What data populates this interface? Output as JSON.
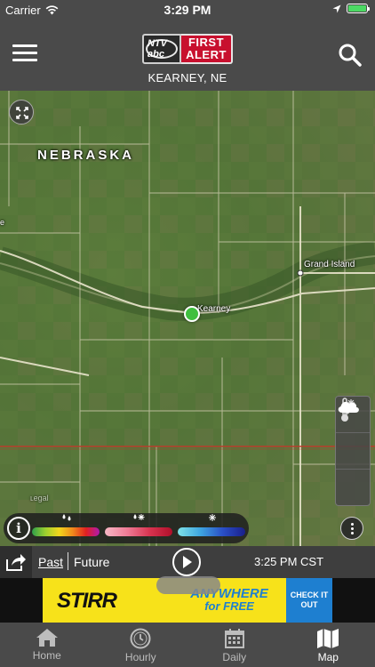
{
  "status_bar": {
    "carrier": "Carrier",
    "time": "3:29 PM"
  },
  "header": {
    "logo": {
      "station": "NTV abc",
      "brand_line1": "FIRST",
      "brand_line2": "ALERT"
    },
    "location": "KEARNEY, NE"
  },
  "map": {
    "state_label": "NEBRASKA",
    "cities": {
      "grand_island": "Grand Island",
      "kearney": "Kearney",
      "lexington_partial": "ʟegal",
      "left_partial": "e"
    }
  },
  "playback": {
    "past_label": "Past",
    "future_label": "Future",
    "timestamp": "3:25 PM CST"
  },
  "ad": {
    "brand": "STIRR",
    "headline": "ANYWHERE",
    "subline": "for FREE",
    "cta": "CHECK IT OUT"
  },
  "tabs": [
    {
      "label": "Home",
      "icon": "home-icon",
      "active": false
    },
    {
      "label": "Hourly",
      "icon": "clock-icon",
      "active": false
    },
    {
      "label": "Daily",
      "icon": "calendar-icon",
      "active": false
    },
    {
      "label": "Map",
      "icon": "map-icon",
      "active": true
    }
  ],
  "colors": {
    "header_bg": "#4a4a4a",
    "brand_red": "#c8102e",
    "location_dot": "#3fbf3f",
    "ad_yellow": "#f7e21a",
    "ad_blue": "#1e7fd0"
  }
}
